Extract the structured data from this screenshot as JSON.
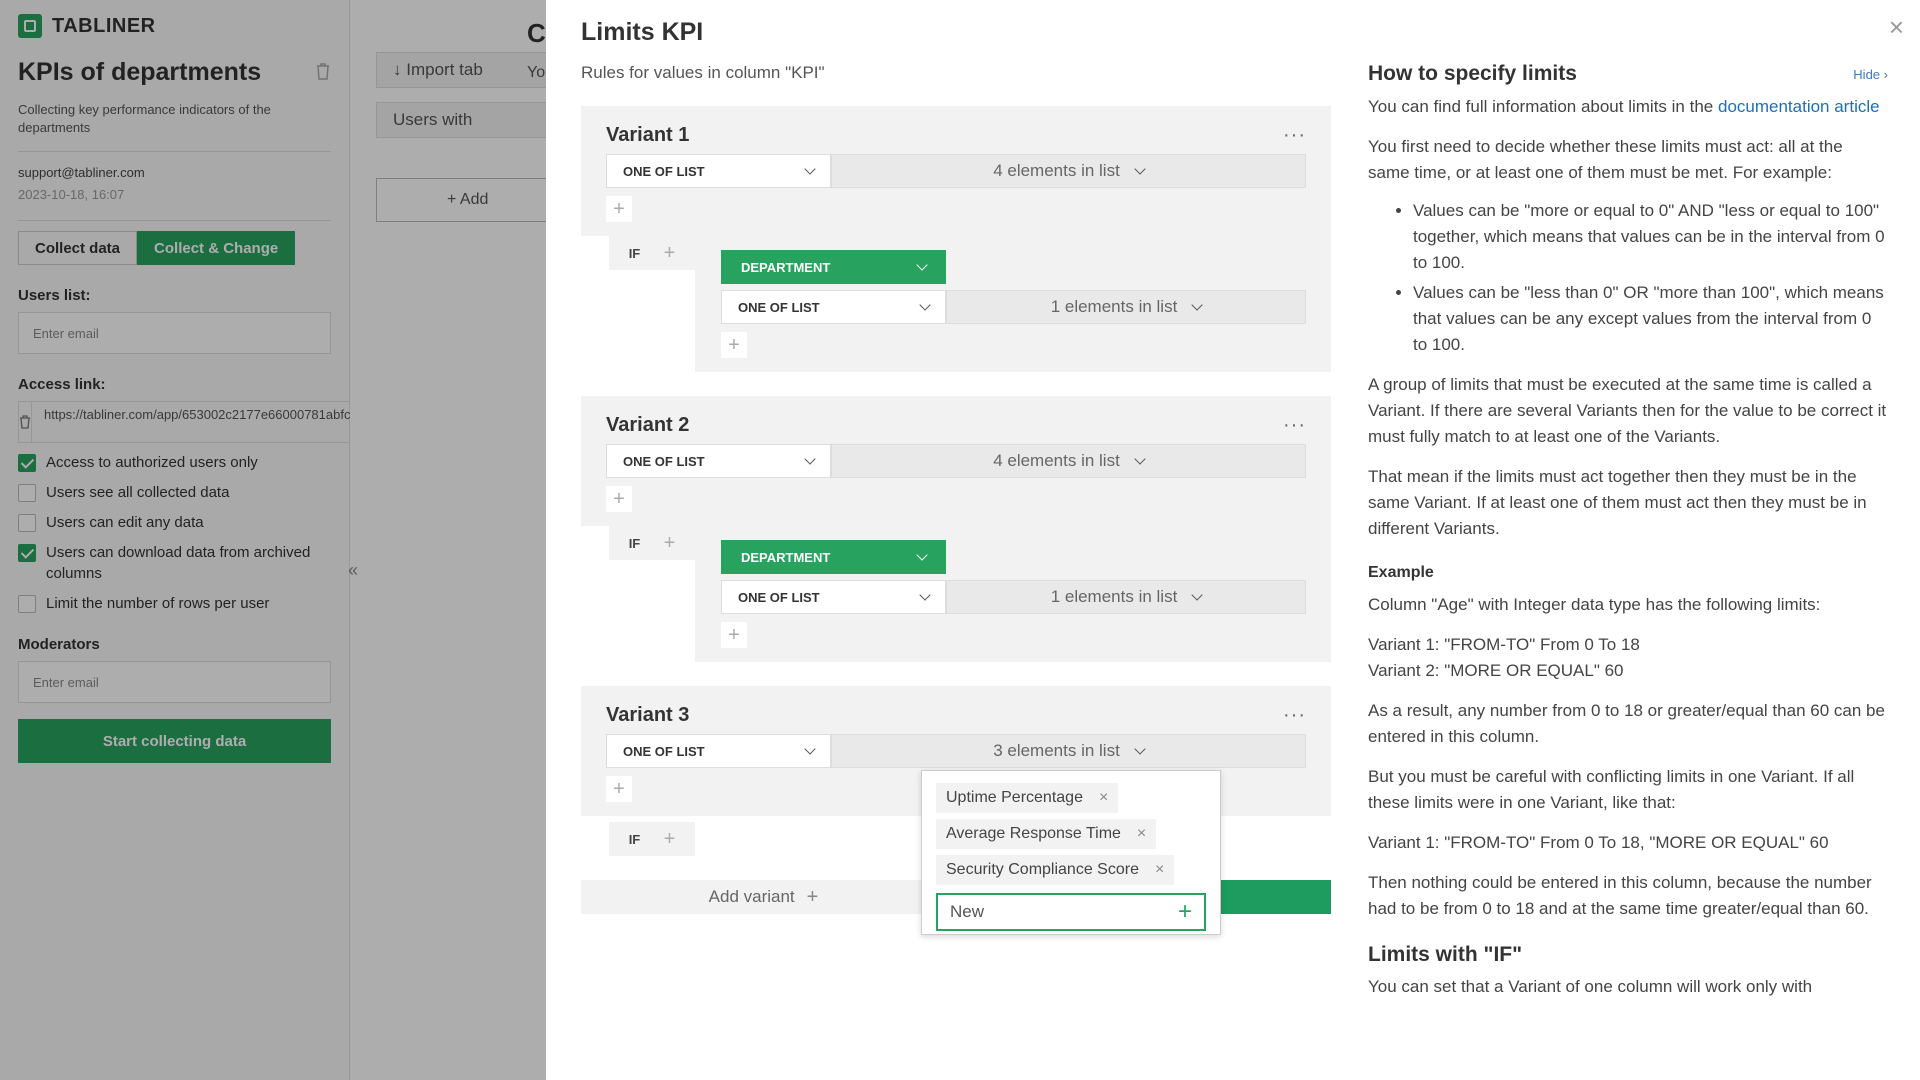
{
  "app": {
    "name": "TABLINER"
  },
  "left_panel": {
    "title": "KPIs of departments",
    "description": "Collecting key performance indicators of the departments",
    "email": "support@tabliner.com",
    "timestamp": "2023-10-18, 16:07",
    "mode_collect": "Collect data",
    "mode_change": "Collect & Change",
    "users_list_label": "Users list:",
    "users_email_placeholder": "Enter email",
    "access_link_label": "Access link:",
    "access_link_url": "https://tabliner.com/app/653002c2177e66000781abfc?",
    "checkboxes": [
      {
        "label": "Access to authorized users only",
        "checked": true
      },
      {
        "label": "Users see all collected data",
        "checked": false
      },
      {
        "label": "Users can edit any data",
        "checked": false
      },
      {
        "label": "Users can download data from archived columns",
        "checked": true
      },
      {
        "label": "Limit the number of rows per user",
        "checked": false
      }
    ],
    "moderators_label": "Moderators",
    "moderators_placeholder": "Enter email",
    "start_button": "Start collecting data"
  },
  "middle_panel": {
    "title": "C",
    "subtitle": "Yo",
    "import_button": "Import tab",
    "users_button": "Users with",
    "add_button": "+ Add"
  },
  "drawer": {
    "title": "Limits KPI",
    "subtitle": "Rules for values in column \"KPI\"",
    "close": "×",
    "variants": [
      {
        "name": "Variant 1",
        "rule": "ONE OF LIST",
        "list": "4 elements in list",
        "condition": {
          "if": "IF",
          "column": "DEPARTMENT",
          "rule": "ONE OF LIST",
          "list": "1 elements in list"
        }
      },
      {
        "name": "Variant 2",
        "rule": "ONE OF LIST",
        "list": "4 elements in list",
        "condition": {
          "if": "IF",
          "column": "DEPARTMENT",
          "rule": "ONE OF LIST",
          "list": "1 elements in list"
        }
      },
      {
        "name": "Variant 3",
        "rule": "ONE OF LIST",
        "list": "3 elements in list",
        "condition": {
          "if": "IF"
        }
      }
    ],
    "add_variant": "Add variant",
    "popup": {
      "tags": [
        "Uptime Percentage",
        "Average Response Time",
        "Security Compliance Score"
      ],
      "new_placeholder": "New"
    }
  },
  "help": {
    "title": "How to specify limits",
    "hide": "Hide",
    "intro": "You can find full information about limits in the",
    "doc_link": "documentation article",
    "p1": "You first need to decide whether these limits must act: all at the same time, or at least one of them must be met. For example:",
    "bullets": [
      "Values can be \"more or equal to 0\" AND \"less or equal to 100\" together, which means that values can be in the interval from 0 to 100.",
      "Values can be \"less than 0\" OR \"more than 100\", which means that values can be any except values from the interval from 0 to 100."
    ],
    "p2": "A group of limits that must be executed at the same time is called a Variant. If there are several Variants then for the value to be correct it must fully match to at least one of the Variants.",
    "p3": "That mean if the limits must act together then they must be in the same Variant. If at least one of them must act then they must be in different Variants.",
    "example_title": "Example",
    "example_line": "Column \"Age\" with Integer data type has the following limits:",
    "example_v1": "Variant 1: \"FROM-TO\" From 0 To 18",
    "example_v2": "Variant 2: \"MORE OR EQUAL\" 60",
    "p4": "As a result, any number from 0 to 18 or greater/equal than 60 can be entered in this column.",
    "p5": "But you must be careful with conflicting limits in one Variant. If all these limits were in one Variant, like that:",
    "p6": "Variant 1: \"FROM-TO\" From 0 To 18, \"MORE OR EQUAL\" 60",
    "p7": "Then nothing could be entered in this column, because the number had to be from 0 to 18 and at the same time greater/equal than 60.",
    "if_title": "Limits with \"IF\"",
    "p8": "You can set that a Variant of one column will work only with"
  },
  "colors": {
    "accent": "#27a35f",
    "link": "#1f6fb8"
  }
}
